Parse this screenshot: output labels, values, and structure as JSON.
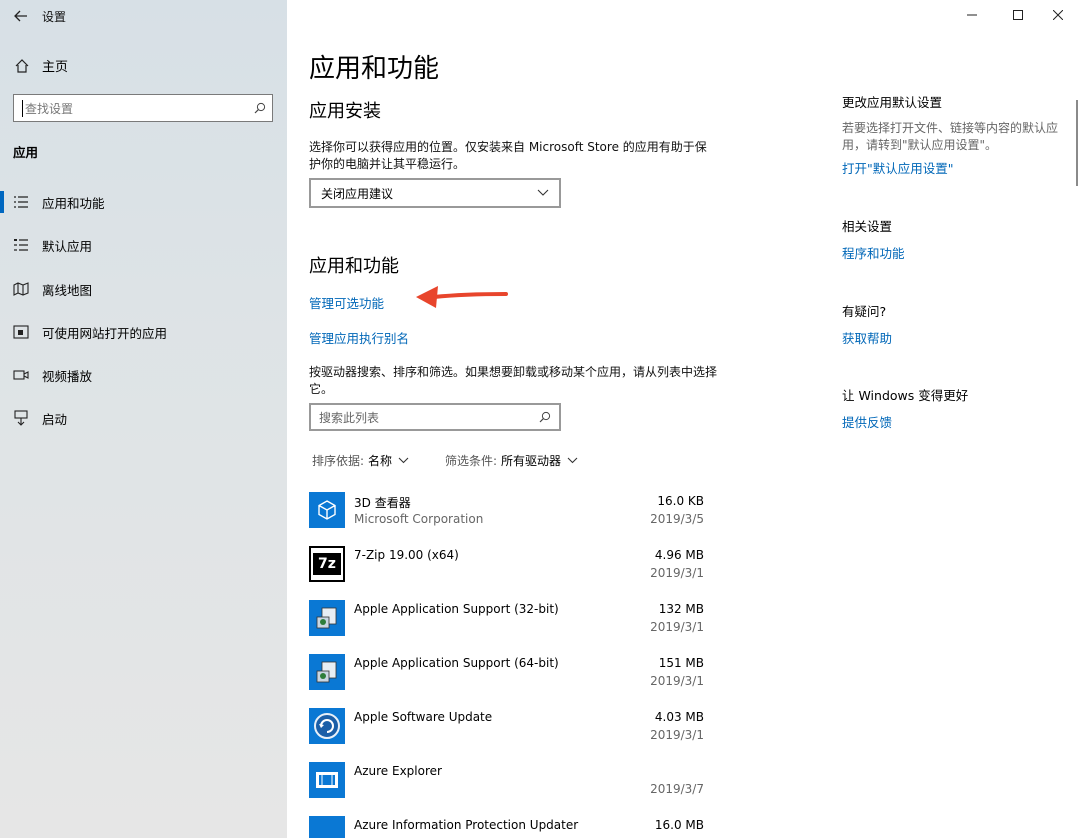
{
  "window": {
    "title": "设置",
    "controls": [
      "minimize",
      "maximize",
      "close"
    ]
  },
  "sidebar": {
    "home_label": "主页",
    "search_placeholder": "查找设置",
    "section": "应用",
    "items": [
      {
        "label": "应用和功能",
        "icon": "apps-features-icon",
        "active": true
      },
      {
        "label": "默认应用",
        "icon": "default-apps-icon",
        "active": false
      },
      {
        "label": "离线地图",
        "icon": "offline-maps-icon",
        "active": false
      },
      {
        "label": "可使用网站打开的应用",
        "icon": "apps-for-websites-icon",
        "active": false
      },
      {
        "label": "视频播放",
        "icon": "video-playback-icon",
        "active": false
      },
      {
        "label": "启动",
        "icon": "startup-icon",
        "active": false
      }
    ]
  },
  "main": {
    "title": "应用和功能",
    "install": {
      "heading": "应用安装",
      "description": "选择你可以获得应用的位置。仅安装来自 Microsoft Store 的应用有助于保护你的电脑并让其平稳运行。",
      "dropdown_value": "关闭应用建议"
    },
    "apps": {
      "heading": "应用和功能",
      "link_optional": "管理可选功能",
      "link_alias": "管理应用执行别名",
      "description": "按驱动器搜索、排序和筛选。如果想要卸载或移动某个应用，请从列表中选择它。",
      "search_placeholder": "搜索此列表",
      "sort_label": "排序依据:",
      "sort_value": "名称",
      "filter_label": "筛选条件:",
      "filter_value": "所有驱动器",
      "list": [
        {
          "name": "3D 查看器",
          "publisher": "Microsoft Corporation",
          "size": "16.0 KB",
          "date": "2019/3/5",
          "icon": "3d-viewer-icon"
        },
        {
          "name": "7-Zip 19.00 (x64)",
          "publisher": "",
          "size": "4.96 MB",
          "date": "2019/3/1",
          "icon": "7zip-icon"
        },
        {
          "name": "Apple Application Support (32-bit)",
          "publisher": "",
          "size": "132 MB",
          "date": "2019/3/1",
          "icon": "installer-icon"
        },
        {
          "name": "Apple Application Support (64-bit)",
          "publisher": "",
          "size": "151 MB",
          "date": "2019/3/1",
          "icon": "installer-icon"
        },
        {
          "name": "Apple Software Update",
          "publisher": "",
          "size": "4.03 MB",
          "date": "2019/3/1",
          "icon": "apple-update-icon"
        },
        {
          "name": "Azure Explorer",
          "publisher": "",
          "size": "",
          "date": "2019/3/7",
          "icon": "azure-explorer-icon"
        },
        {
          "name": "Azure Information Protection Updater",
          "publisher": "",
          "size": "16.0 MB",
          "date": "",
          "icon": "azure-info-icon"
        }
      ]
    }
  },
  "right": {
    "defaults": {
      "title": "更改应用默认设置",
      "text": "若要选择打开文件、链接等内容的默认应用，请转到\"默认应用设置\"。",
      "link": "打开\"默认应用设置\""
    },
    "related": {
      "title": "相关设置",
      "link": "程序和功能"
    },
    "help": {
      "title": "有疑问?",
      "link": "获取帮助"
    },
    "feedback": {
      "title": "让 Windows 变得更好",
      "link": "提供反馈"
    }
  },
  "colors": {
    "accent": "#0067b8",
    "annotation_arrow": "#e8452c"
  }
}
